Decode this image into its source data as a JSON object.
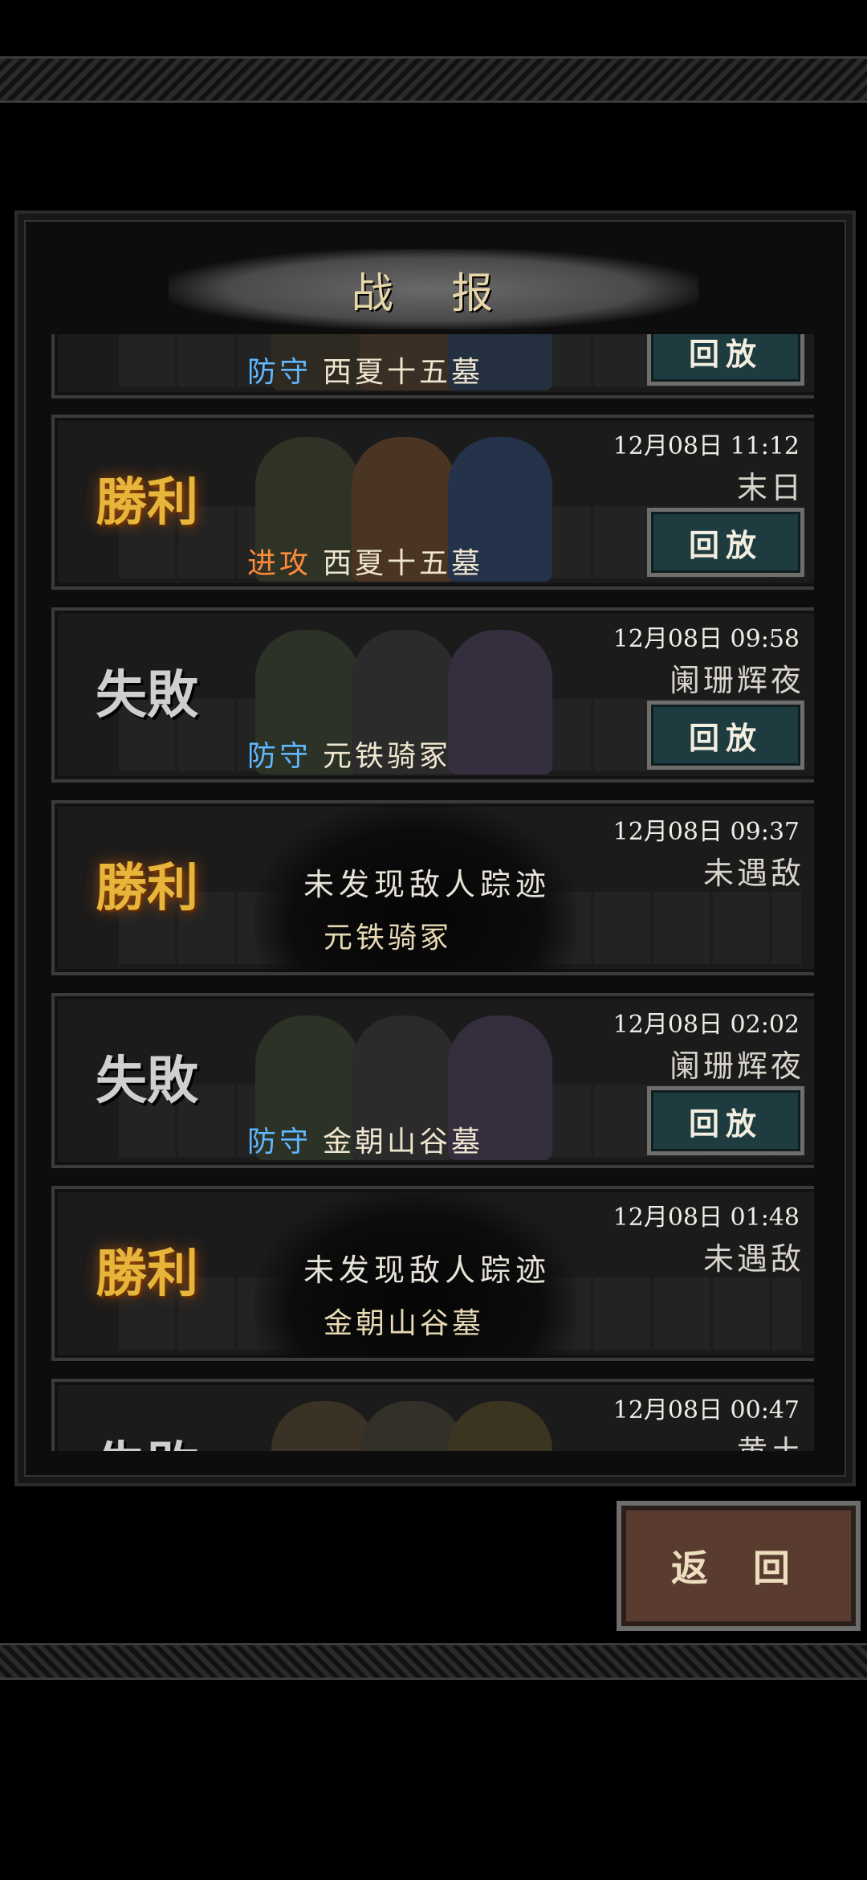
{
  "header": {
    "title": "战 报"
  },
  "records": [
    {
      "result": "",
      "date": "",
      "enemy": "",
      "role": "防守",
      "role_type": "defend",
      "place": "西夏十五墓",
      "replay": "回放",
      "type": "battle"
    },
    {
      "result": "勝利",
      "result_type": "win",
      "date": "12月08日 11:12",
      "enemy": "末日",
      "role": "进攻",
      "role_type": "attack",
      "place": "西夏十五墓",
      "replay": "回放",
      "type": "battle"
    },
    {
      "result": "失敗",
      "result_type": "lose",
      "date": "12月08日 09:58",
      "enemy": "阑珊辉夜",
      "role": "防守",
      "role_type": "defend",
      "place": "元铁骑冢",
      "replay": "回放",
      "type": "battle"
    },
    {
      "result": "勝利",
      "result_type": "win",
      "date": "12月08日 09:37",
      "enemy": "未遇敌",
      "nofound": "未发现敌人踪迹",
      "place": "元铁骑冢",
      "type": "empty"
    },
    {
      "result": "失敗",
      "result_type": "lose",
      "date": "12月08日 02:02",
      "enemy": "阑珊辉夜",
      "role": "防守",
      "role_type": "defend",
      "place": "金朝山谷墓",
      "replay": "回放",
      "type": "battle"
    },
    {
      "result": "勝利",
      "result_type": "win",
      "date": "12月08日 01:48",
      "enemy": "未遇敌",
      "nofound": "未发现敌人踪迹",
      "place": "金朝山谷墓",
      "type": "empty"
    },
    {
      "result": "失敗",
      "result_type": "lose",
      "date": "12月08日 00:47",
      "enemy": "黄土",
      "type": "partial"
    }
  ],
  "footer": {
    "back_label": "返 回"
  },
  "colors": {
    "win": "#e6b53a",
    "lose": "#cfcfcf",
    "defend": "#5fb8ff",
    "attack": "#ff8a3a",
    "replay_bg": "#1e3b40",
    "back_bg": "#5a3b30"
  }
}
